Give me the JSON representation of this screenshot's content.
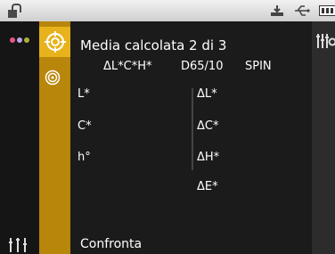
{
  "status_bar": {
    "icons": [
      "unlock-icon",
      "tray-icon",
      "usb-icon",
      "battery-icon"
    ]
  },
  "nav": {
    "icons": [
      "dots-icon",
      "target-icon",
      "ring-icon",
      "sliders-icon"
    ]
  },
  "header": {
    "title": "Media calcolata 2 di 3",
    "col_diff": "ΔL*C*H*",
    "illuminant": "D65/10",
    "mode": "SPIN"
  },
  "left_labels": [
    "L*",
    "C*",
    "h°"
  ],
  "right_labels": [
    "ΔL*",
    "ΔC*",
    "ΔH*",
    "ΔE*"
  ],
  "footer": {
    "compare_label": "Confronta"
  },
  "colors": {
    "gold": "#b8860b",
    "gold_active": "#e7b21b",
    "dot_pink": "#e4578a",
    "dot_lilac": "#b9a6e6",
    "dot_olive": "#b2ad3b"
  }
}
